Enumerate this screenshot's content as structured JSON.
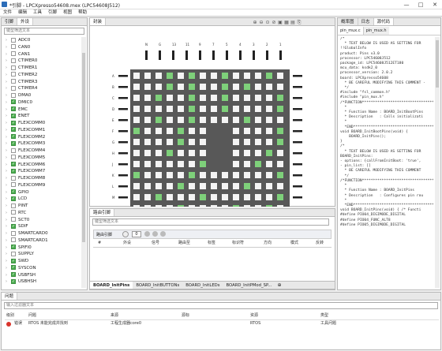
{
  "window": {
    "title": "*引脚 - LPCXpresso54608.mex (LPC54608J512)",
    "min": "—",
    "max": "□",
    "close": "✕"
  },
  "menu": [
    "文件",
    "编辑",
    "工具",
    "引脚",
    "视图",
    "帮助"
  ],
  "left": {
    "tabs": [
      "引脚",
      "外设"
    ],
    "filter_placeholder": "键型筛选文本",
    "items": [
      {
        "label": "ADC0",
        "checked": false
      },
      {
        "label": "CAN0",
        "checked": false
      },
      {
        "label": "CAN1",
        "checked": false
      },
      {
        "label": "CTIMER0",
        "checked": false
      },
      {
        "label": "CTIMER1",
        "checked": false
      },
      {
        "label": "CTIMER2",
        "checked": false
      },
      {
        "label": "CTIMER3",
        "checked": false
      },
      {
        "label": "CTIMER4",
        "checked": false
      },
      {
        "label": "DMA0",
        "checked": false
      },
      {
        "label": "DMIC0",
        "checked": true
      },
      {
        "label": "EMC",
        "checked": true
      },
      {
        "label": "ENET",
        "checked": true
      },
      {
        "label": "FLEXCOMM0",
        "checked": true
      },
      {
        "label": "FLEXCOMM1",
        "checked": true
      },
      {
        "label": "FLEXCOMM2",
        "checked": true
      },
      {
        "label": "FLEXCOMM3",
        "checked": true
      },
      {
        "label": "FLEXCOMM4",
        "checked": false
      },
      {
        "label": "FLEXCOMM5",
        "checked": false
      },
      {
        "label": "FLEXCOMM6",
        "checked": true
      },
      {
        "label": "FLEXCOMM7",
        "checked": true
      },
      {
        "label": "FLEXCOMM8",
        "checked": false
      },
      {
        "label": "FLEXCOMM9",
        "checked": false
      },
      {
        "label": "GPIO",
        "checked": true
      },
      {
        "label": "LCD",
        "checked": true
      },
      {
        "label": "PINT",
        "checked": false
      },
      {
        "label": "RTC",
        "checked": false
      },
      {
        "label": "SCT0",
        "checked": false
      },
      {
        "label": "SDIF",
        "checked": true
      },
      {
        "label": "SMARTCARD0",
        "checked": false
      },
      {
        "label": "SMARTCARD1",
        "checked": false
      },
      {
        "label": "SPIFI0",
        "checked": true
      },
      {
        "label": "SUPPLY",
        "checked": false
      },
      {
        "label": "SWD",
        "checked": true
      },
      {
        "label": "SYSCON",
        "checked": true
      },
      {
        "label": "USBFSH",
        "checked": true
      },
      {
        "label": "USBHSH",
        "checked": true
      }
    ]
  },
  "package": {
    "tab": "封装",
    "top_labels": [
      "N",
      "G",
      "13",
      "11",
      "9",
      "7",
      "5",
      "4",
      "3",
      "2",
      "1"
    ],
    "row_labels": [
      "A",
      "B",
      "C",
      "D",
      "E",
      "F",
      "G",
      "H",
      "J",
      "K",
      "L",
      "M",
      "N",
      "P"
    ],
    "colors": {
      "bg": "#585858",
      "green": "#7ed07a",
      "white": "#f4f4f4"
    }
  },
  "routing": {
    "tab": "路由引脚",
    "filter_placeholder": "键型筛选文本",
    "toolbar_label": "路由引脚",
    "count": "0",
    "columns": [
      "#",
      "外设",
      "信号",
      "路由至",
      "标签",
      "标识符",
      "方向",
      "模式",
      "反转"
    ]
  },
  "bottom_tabs": [
    "BOARD_InitPins",
    "BOARD_InitBUTTONs",
    "BOARD_InitLEDs",
    "BOARD_InitPMod_SP..."
  ],
  "right": {
    "tabs": [
      "概率图",
      "日志",
      "源代码"
    ],
    "file_tabs": [
      "pin_mux.c",
      "pin_mux.h"
    ],
    "code": [
      "/*",
      "  * TEXT BELOW IS USED AS SETTING FOR",
      "!!GlobalInfo",
      "product: Pins v3.0",
      "processor: LPC54608J512",
      "package_id: LPC54608J512ET180",
      "mcu_data: ksdk2_0",
      "processor_version: 2.0.2",
      "board: LPCXpresso54608",
      "  * BE CAREFUL MODIFYING THIS COMMENT -",
      "  */",
      "",
      "#include \"fsl_common.h\"",
      "#include \"pin_mux.h\"",
      "",
      "/*FUNCTION*********************************",
      "  *",
      "  * Function Name : BOARD_InitBootPins",
      "  * Description   : Calls initializati",
      "  *",
      "  *END**************************************",
      "void BOARD_InitBootPins(void) {",
      "    BOARD_InitPins();",
      "}",
      "",
      "/*",
      "  * TEXT BELOW IS USED AS SETTING FOR",
      "BOARD_InitPins:",
      "- options: {callFromInitBoot: 'true',",
      "- pin_list: []",
      "  * BE CAREFUL MODIFYING THIS COMMENT",
      "  */",
      "",
      "/*FUNCTION*********************************",
      "  *",
      "  * Function Name : BOARD_InitPins",
      "  * Description   : Configures pin rou",
      "  *",
      "  *END**************************************",
      "void BOARD_InitPins(void) { /* Functi",
      "",
      "",
      "#define PIO04_DIGIMODE_DIGITAL",
      "#define PIO04_FUNC_ALT8",
      "#define PIO05_DIGIMODE_DIGITAL"
    ]
  },
  "problems": {
    "tab": "问题",
    "filter_placeholder": "输入过滤器文本",
    "columns": [
      "级别",
      "问题",
      "来源",
      "源标",
      "资源",
      "类型"
    ],
    "rows": [
      {
        "level": "错误",
        "issue": "RTOS 未能完成并找到",
        "source": "工程生成器core0",
        "res": "RTOS",
        "type": "工具问题"
      }
    ]
  }
}
